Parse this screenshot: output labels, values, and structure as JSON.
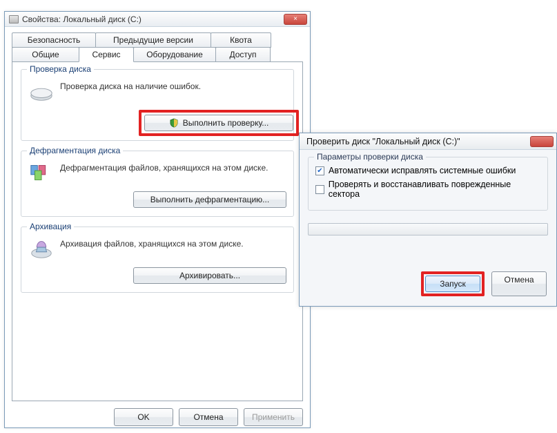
{
  "propwin": {
    "title": "Свойства: Локальный диск (C:)",
    "close_x": "×",
    "tab_row1": [
      "Безопасность",
      "Предыдущие версии",
      "Квота"
    ],
    "tab_row2": [
      "Общие",
      "Сервис",
      "Оборудование",
      "Доступ"
    ],
    "active_tab_index_row2": 1,
    "group_check": {
      "legend": "Проверка диска",
      "text": "Проверка диска на наличие ошибок.",
      "button": "Выполнить проверку..."
    },
    "group_defrag": {
      "legend": "Дефрагментация диска",
      "text": "Дефрагментация файлов, хранящихся на этом диске.",
      "button": "Выполнить дефрагментацию..."
    },
    "group_archive": {
      "legend": "Архивация",
      "text": "Архивация файлов, хранящихся на этом диске.",
      "button": "Архивировать..."
    },
    "buttons": {
      "ok": "OK",
      "cancel": "Отмена",
      "apply": "Применить"
    }
  },
  "checkwin": {
    "title": "Проверить диск \"Локальный диск (C:)\"",
    "group_legend": "Параметры проверки диска",
    "opt_autofix": "Автоматически исправлять системные ошибки",
    "opt_scanrecover": "Проверять и восстанавливать поврежденные сектора",
    "opt_autofix_checked": true,
    "opt_scanrecover_checked": false,
    "buttons": {
      "start": "Запуск",
      "cancel": "Отмена"
    }
  }
}
